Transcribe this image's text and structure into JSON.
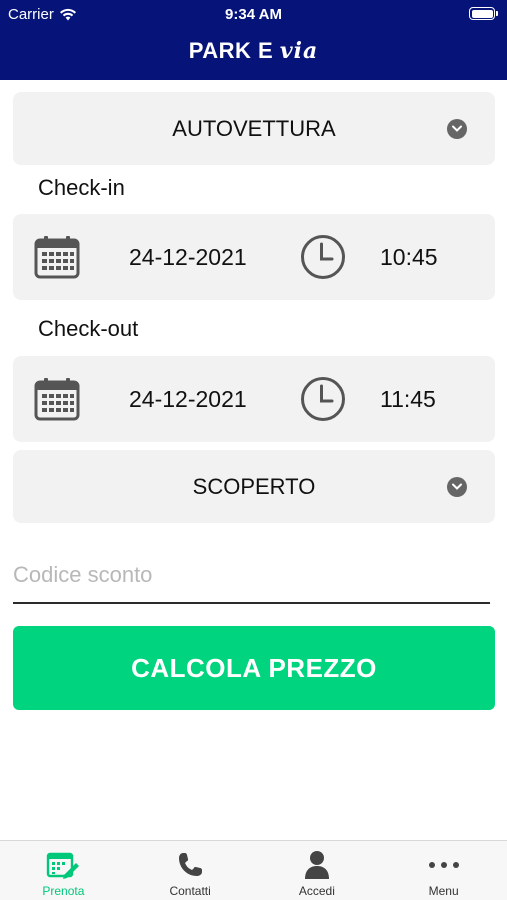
{
  "status_bar": {
    "carrier": "Carrier",
    "time": "9:34 AM"
  },
  "header": {
    "brand_a": "PARK E ",
    "brand_b": "via"
  },
  "vehicle_select": {
    "value": "AUTOVETTURA"
  },
  "checkin": {
    "label": "Check-in",
    "date": "24-12-2021",
    "time": "10:45"
  },
  "checkout": {
    "label": "Check-out",
    "date": "24-12-2021",
    "time": "11:45"
  },
  "parking_select": {
    "value": "SCOPERTO"
  },
  "discount": {
    "placeholder": "Codice sconto",
    "value": ""
  },
  "calculate_button": {
    "label": "CALCOLA PREZZO"
  },
  "tabbar": {
    "items": [
      {
        "label": "Prenota",
        "icon": "calendar-edit-icon",
        "active": true
      },
      {
        "label": "Contatti",
        "icon": "phone-icon",
        "active": false
      },
      {
        "label": "Accedi",
        "icon": "user-icon",
        "active": false
      },
      {
        "label": "Menu",
        "icon": "more-dots-icon",
        "active": false
      }
    ]
  },
  "colors": {
    "header": "#06147a",
    "accent": "#00d47e",
    "card": "#f2f2f2",
    "active_tab": "#00c87a"
  }
}
